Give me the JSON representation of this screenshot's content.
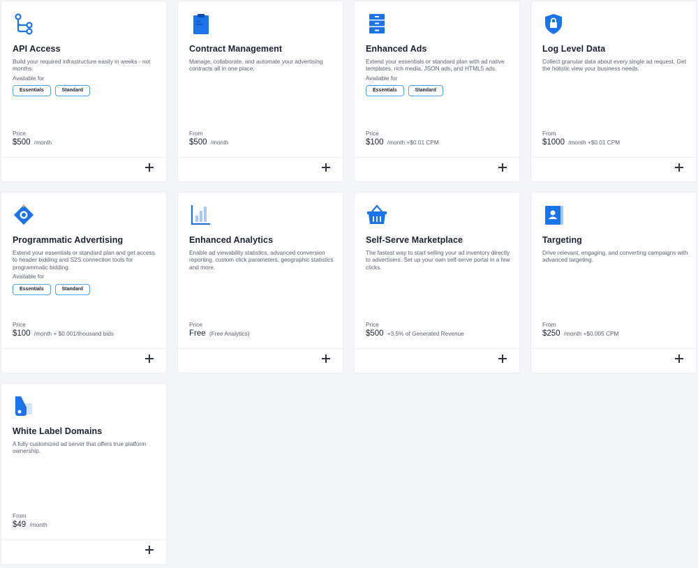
{
  "colors": {
    "accent": "#1a73e8",
    "chip_border": "#4fa3e6",
    "background": "#f4f5f8"
  },
  "cards": [
    {
      "icon": "api-icon",
      "title": "API Access",
      "description": "Build your required infrastructure easily in weeks - not months.",
      "available_for_label": "Available for",
      "chips": [
        "Essentials",
        "Standard"
      ],
      "price_label": "Price",
      "price": "$500",
      "price_unit": "/month"
    },
    {
      "icon": "clipboard-icon",
      "title": "Contract Management",
      "description": "Manage, collaborate, and automate your advertising contracts all in one place.",
      "price_label": "From",
      "price": "$500",
      "price_unit": "/month"
    },
    {
      "icon": "filing-cabinet-icon",
      "title": "Enhanced Ads",
      "description": "Extend your essentials or standard plan with ad native templates, rich media, JSON ads, and HTML5 ads.",
      "available_for_label": "Available for",
      "chips": [
        "Essentials",
        "Standard"
      ],
      "price_label": "Price",
      "price": "$100",
      "price_unit": "/month +$0.01 CPM"
    },
    {
      "icon": "shield-lock-icon",
      "title": "Log Level Data",
      "description": "Collect granular data about every single ad request. Get the holistic view your business needs.",
      "price_label": "From",
      "price": "$1000",
      "price_unit": "/month +$0.01 CPM"
    },
    {
      "icon": "target-diamond-icon",
      "title": "Programmatic Advertising",
      "description": "Extend your essentials or standard plan and get access to header bidding and S2S connection tools for programmatic bidding.",
      "available_for_label": "Available for",
      "chips": [
        "Essentials",
        "Standard"
      ],
      "price_label": "Price",
      "price": "$100",
      "price_unit": "/month + $0.001/thousand bids"
    },
    {
      "icon": "bar-chart-icon",
      "title": "Enhanced Analytics",
      "description": "Enable ad viewability statistics, advanced conversion reporting, custom click parameters, geographic statistics and more.",
      "price_label": "Price",
      "price": "Free",
      "price_unit": "(Free Analytics)"
    },
    {
      "icon": "basket-icon",
      "title": "Self-Serve Marketplace",
      "description": "The fastest way to start selling your ad inventory directly to advertisers. Set up your own self-serve portal in a few clicks.",
      "price_label": "Price",
      "price": "$500",
      "price_unit": "+3.5% of Generated Revenue"
    },
    {
      "icon": "contact-card-icon",
      "title": "Targeting",
      "description": "Drive relevant, engaging, and converting campaigns with advanced targeting.",
      "price_label": "From",
      "price": "$250",
      "price_unit": "/month +$0.005 CPM"
    },
    {
      "icon": "label-tag-icon",
      "title": "White Label Domains",
      "description": "A fully customized ad server that offers true platform ownership.",
      "price_label": "From",
      "price": "$49",
      "price_unit": "/month"
    }
  ]
}
